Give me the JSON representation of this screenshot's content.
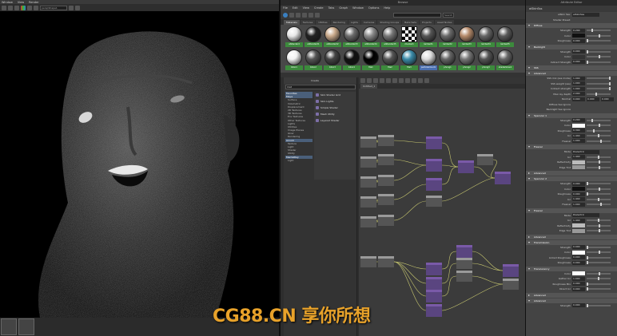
{
  "render_view": {
    "menu": [
      "Window",
      "View",
      "Render"
    ],
    "camera": "perspShape1",
    "thumbnail_count": 2
  },
  "hypershade": {
    "title": "Browse",
    "menu": [
      "File",
      "Edit",
      "View",
      "Create",
      "Tabs",
      "Graph",
      "Window",
      "Options",
      "Help"
    ],
    "search_label": "Search",
    "browser_tabs": [
      "Materials",
      "Textures",
      "Utilities",
      "Rendering",
      "Lights",
      "Cameras",
      "Shading Groups",
      "Bake Sets",
      "Projects",
      "Asset Nodes"
    ],
    "swatches": [
      {
        "label": "aiStandard",
        "tone": "#e8e8e8"
      },
      {
        "label": "aiStandard1",
        "tone": "#222"
      },
      {
        "label": "aiStandard2",
        "tone": "#c9a98a"
      },
      {
        "label": "aiStandard3",
        "tone": "#6b6b6b"
      },
      {
        "label": "aiStandard4",
        "tone": "#8a8a8a"
      },
      {
        "label": "aiStandard5",
        "tone": "#777"
      },
      {
        "label": "checker1",
        "tone": "checker"
      },
      {
        "label": "lambert1",
        "tone": "#555"
      },
      {
        "label": "lambert2",
        "tone": "#6a6a6a"
      },
      {
        "label": "lambert3",
        "tone": "#b58a6a"
      },
      {
        "label": "lambert4",
        "tone": "#666"
      },
      {
        "label": "lambert5",
        "tone": "#5a5a5a"
      },
      {
        "label": "blinn1",
        "tone": "#f2f2f2"
      },
      {
        "label": "blinn2",
        "tone": "#555"
      },
      {
        "label": "blinn3",
        "tone": "#444"
      },
      {
        "label": "blinn4",
        "tone": "#111"
      },
      {
        "label": "file1",
        "tone": "#000"
      },
      {
        "label": "file2",
        "tone": "#555"
      },
      {
        "label": "file3",
        "tone": "#3a8aa8"
      },
      {
        "label": "particleCloud1",
        "tone": "#ddd"
      },
      {
        "label": "phong1",
        "tone": "#666"
      },
      {
        "label": "phong2",
        "tone": "#777"
      },
      {
        "label": "phong3",
        "tone": "#555"
      },
      {
        "label": "shaderGlow1",
        "tone": "#666"
      }
    ],
    "create": {
      "title": "Create",
      "search_value": "mat",
      "tree": [
        {
          "text": "Favorites",
          "head": true
        },
        {
          "text": "Maya",
          "head": true
        },
        {
          "text": "Surface",
          "head": false
        },
        {
          "text": "Volumetric",
          "head": false
        },
        {
          "text": "Displacement",
          "head": false
        },
        {
          "text": "2D Textures",
          "head": false
        },
        {
          "text": "3D Textures",
          "head": false
        },
        {
          "text": "Env Textures",
          "head": false
        },
        {
          "text": "Other Textures",
          "head": false
        },
        {
          "text": "Lights",
          "head": false
        },
        {
          "text": "Utilities",
          "head": false
        },
        {
          "text": "Image Planes",
          "head": false
        },
        {
          "text": "Glow",
          "head": false
        },
        {
          "text": "Rendering",
          "head": false
        },
        {
          "text": "Arnold",
          "head": true
        },
        {
          "text": "Texture",
          "head": false
        },
        {
          "text": "Light",
          "head": false
        },
        {
          "text": "Shader",
          "head": false
        },
        {
          "text": "Utility",
          "head": false
        },
        {
          "text": "MentalRay",
          "head": true
        },
        {
          "text": "Light",
          "head": false
        }
      ],
      "items": [
        "Skin Shader Grid",
        "Skin Lights",
        "Simple Shader",
        "Mesh Utility",
        "Layered Shader"
      ]
    },
    "node_editor_tabs": [
      "Untitled_1"
    ]
  },
  "attribute_editor": {
    "title": "Attribute Editor",
    "node_tab": "aiSkinSss",
    "rows": [
      {
        "kind": "field",
        "label": "aiSkin Sss:",
        "value": "aiSkinSss"
      },
      {
        "kind": "label",
        "label": "Shader Preset:",
        "value": ""
      },
      {
        "kind": "section",
        "label": "Diffuse"
      },
      {
        "kind": "slider",
        "label": "Strength",
        "value": "0.200",
        "pos": 0.2
      },
      {
        "kind": "color",
        "label": "Color",
        "color": "#111111"
      },
      {
        "kind": "slider",
        "label": "Roughness",
        "value": "0.000",
        "pos": 0.0
      },
      {
        "kind": "section",
        "label": "Backlight"
      },
      {
        "kind": "slider",
        "label": "Strength",
        "value": "0.000",
        "pos": 0.0
      },
      {
        "kind": "color",
        "label": "Color",
        "color": "#333333"
      },
      {
        "kind": "slider",
        "label": "Indirect Strength",
        "value": "0.000",
        "pos": 0.0
      },
      {
        "kind": "section",
        "label": "SSS"
      },
      {
        "kind": "section",
        "label": "Advanced"
      },
      {
        "kind": "slider",
        "label": "SSS mix (sss mode)",
        "value": "1.000",
        "pos": 1.0
      },
      {
        "kind": "slider",
        "label": "SSS weight (sss)",
        "value": "1.000",
        "pos": 1.0
      },
      {
        "kind": "slider",
        "label": "Indirect strength",
        "value": "1.000",
        "pos": 1.0
      },
      {
        "kind": "slider",
        "label": "Max ray depth",
        "value": "2.000",
        "pos": 0.4
      },
      {
        "kind": "triple",
        "label": "Normal",
        "value": "0.000"
      },
      {
        "kind": "label",
        "label": "Diffuse Sss Ignore",
        "value": ""
      },
      {
        "kind": "label",
        "label": "Backlight Sss Ignore",
        "value": ""
      },
      {
        "kind": "section",
        "label": "Specular 1"
      },
      {
        "kind": "slider",
        "label": "Strength",
        "value": "0.200",
        "pos": 0.2
      },
      {
        "kind": "color",
        "label": "Color",
        "color": "#ffffff"
      },
      {
        "kind": "slider",
        "label": "Roughness",
        "value": "0.300",
        "pos": 0.3
      },
      {
        "kind": "slider",
        "label": "Ior",
        "value": "1.440",
        "pos": 0.5
      },
      {
        "kind": "slider",
        "label": "Fresnel",
        "value": "1.000",
        "pos": 0.6
      },
      {
        "kind": "section",
        "label": "Fresnel"
      },
      {
        "kind": "field",
        "label": "Mode",
        "value": "Dielectric"
      },
      {
        "kind": "slider",
        "label": "Ior",
        "value": "1.440",
        "pos": 0.5
      },
      {
        "kind": "color",
        "label": "Reflectivity",
        "color": "#bbbbbb"
      },
      {
        "kind": "color",
        "label": "Edge Tint",
        "color": "#999999"
      },
      {
        "kind": "section",
        "label": "Advanced",
        "collapsed": true
      },
      {
        "kind": "section",
        "label": "Specular 2"
      },
      {
        "kind": "slider",
        "label": "Strength",
        "value": "0.000",
        "pos": 0.0
      },
      {
        "kind": "color",
        "label": "Color",
        "color": "#111111"
      },
      {
        "kind": "slider",
        "label": "Roughness",
        "value": "0.000",
        "pos": 0.0
      },
      {
        "kind": "slider",
        "label": "Ior",
        "value": "1.440",
        "pos": 0.5
      },
      {
        "kind": "slider",
        "label": "Fresnel",
        "value": "1.000",
        "pos": 0.6
      },
      {
        "kind": "section",
        "label": "Fresnel"
      },
      {
        "kind": "field",
        "label": "Mode",
        "value": "Dielectric"
      },
      {
        "kind": "slider",
        "label": "Ior",
        "value": "1.440",
        "pos": 0.5
      },
      {
        "kind": "color",
        "label": "Reflectivity",
        "color": "#bbbbbb"
      },
      {
        "kind": "color",
        "label": "Edge Tint",
        "color": "#999999"
      },
      {
        "kind": "section",
        "label": "Advanced",
        "collapsed": true
      },
      {
        "kind": "section",
        "label": "Transmission"
      },
      {
        "kind": "slider",
        "label": "Strength",
        "value": "0.000",
        "pos": 0.0
      },
      {
        "kind": "color",
        "label": "Color",
        "color": "#ffffff"
      },
      {
        "kind": "slider",
        "label": "Linked Roughness",
        "value": "0.000",
        "pos": 0.0
      },
      {
        "kind": "slider",
        "label": "Roughness",
        "value": "0.000",
        "pos": 0.0
      },
      {
        "kind": "section",
        "label": "Translucency"
      },
      {
        "kind": "color",
        "label": "Color",
        "color": "#ffffff"
      },
      {
        "kind": "slider",
        "label": "Gather Ior",
        "value": "1.000",
        "pos": 0.5
      },
      {
        "kind": "slider",
        "label": "Roughness Mix",
        "value": "0.000",
        "pos": 0.0
      },
      {
        "kind": "slider",
        "label": "Direct Ior",
        "value": "0.000",
        "pos": 0.0
      },
      {
        "kind": "section",
        "label": "Advanced",
        "collapsed": true
      },
      {
        "kind": "section",
        "label": "Advanced"
      },
      {
        "kind": "slider",
        "label": "Strength",
        "value": "0.000",
        "pos": 0.0
      }
    ]
  },
  "watermark": "CG88.CN 享你所想",
  "colors": {
    "node_purple": "#7a5aa8",
    "node_gray": "#9a9a9a",
    "wire": "#c8c870",
    "watermark": "#e8a22a"
  }
}
